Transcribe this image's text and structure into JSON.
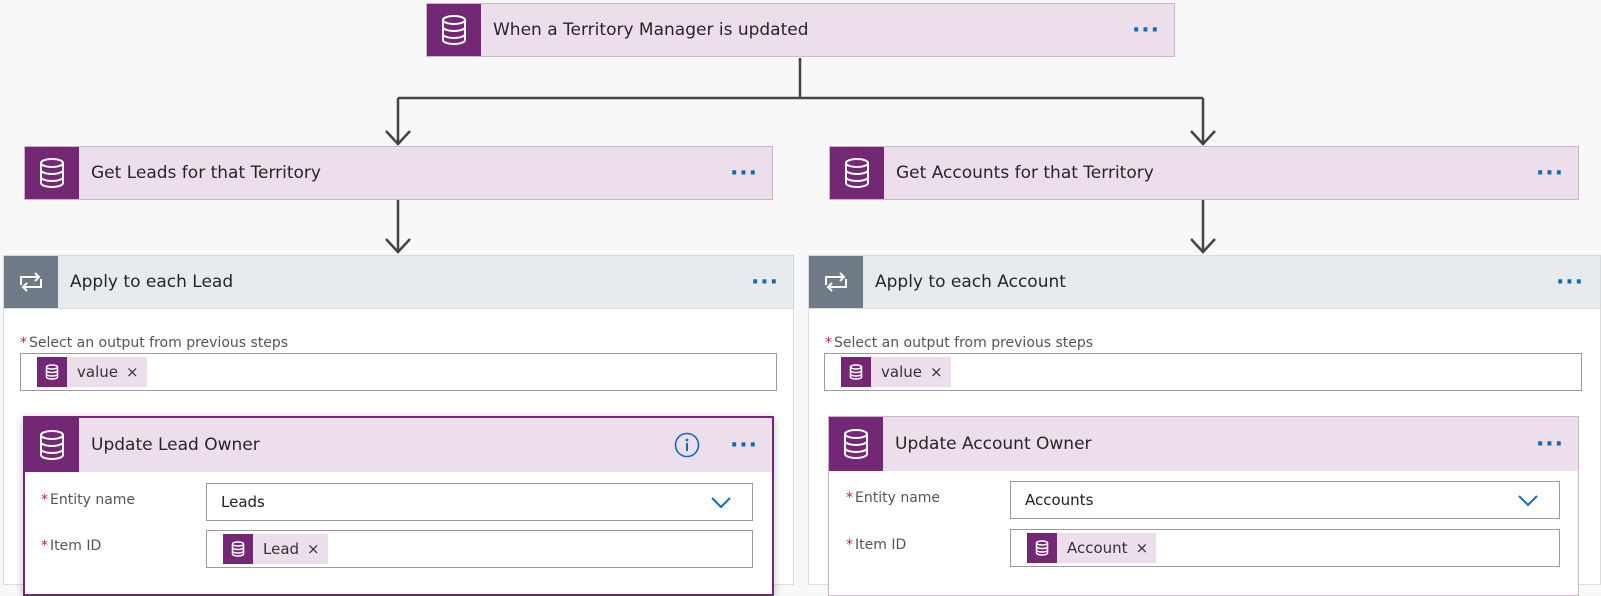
{
  "trigger": {
    "title": "When a Territory Manager is updated",
    "icon": "database-icon"
  },
  "left_branch": {
    "get_step": {
      "title": "Get Leads for that Territory",
      "icon": "database-icon"
    },
    "loop": {
      "title": "Apply to each Lead",
      "icon": "loop-icon",
      "select_label": "Select an output from previous steps",
      "select_token": "value",
      "action": {
        "title": "Update Lead Owner",
        "entity_label": "Entity name",
        "entity_value": "Leads",
        "item_label": "Item ID",
        "item_token": "Lead"
      }
    }
  },
  "right_branch": {
    "get_step": {
      "title": "Get Accounts for that Territory",
      "icon": "database-icon"
    },
    "loop": {
      "title": "Apply to each Account",
      "icon": "loop-icon",
      "select_label": "Select an output from previous steps",
      "select_token": "value",
      "action": {
        "title": "Update Account Owner",
        "entity_label": "Entity name",
        "entity_value": "Accounts",
        "item_label": "Item ID",
        "item_token": "Account"
      }
    }
  },
  "menu_glyph": "···",
  "remove_glyph": "×",
  "required_glyph": "*",
  "colors": {
    "accent": "#742774",
    "card": "#ecdfeb",
    "link": "#0f6cbd",
    "loop": "#6f7a86"
  }
}
